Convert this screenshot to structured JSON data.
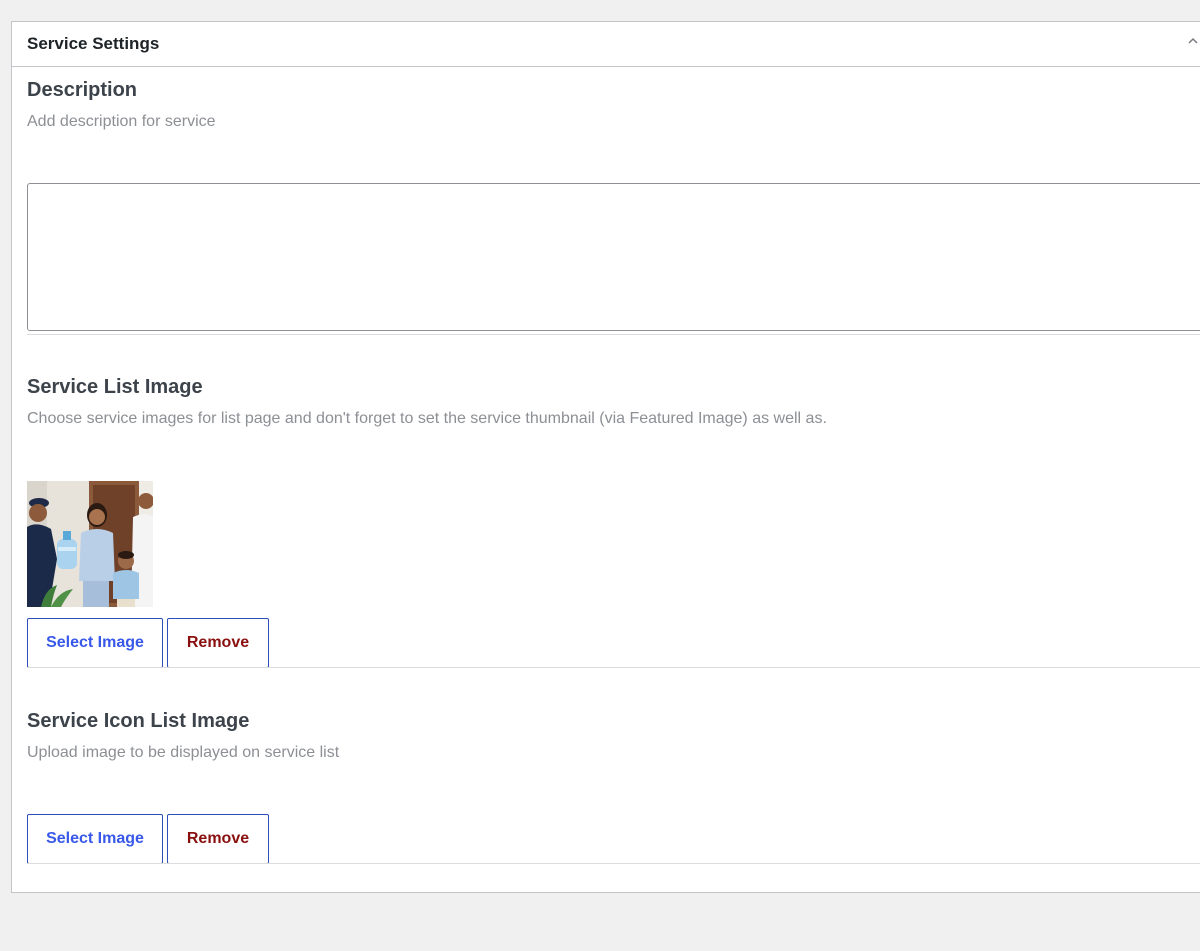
{
  "metabox": {
    "title": "Service Settings"
  },
  "description_field": {
    "title": "Description",
    "help": "Add description for service",
    "value": ""
  },
  "service_list_image": {
    "title": "Service List Image",
    "help": "Choose service images for list page and don't forget to set the service thumbnail (via Featured Image) as well as.",
    "select_label": "Select Image",
    "remove_label": "Remove"
  },
  "service_icon_list_image": {
    "title": "Service Icon List Image",
    "help": "Upload image to be displayed on service list",
    "select_label": "Select Image",
    "remove_label": "Remove"
  },
  "colors": {
    "select_text": "#3858e9",
    "remove_text": "#8a1010",
    "button_border": "#2d4fb8"
  }
}
